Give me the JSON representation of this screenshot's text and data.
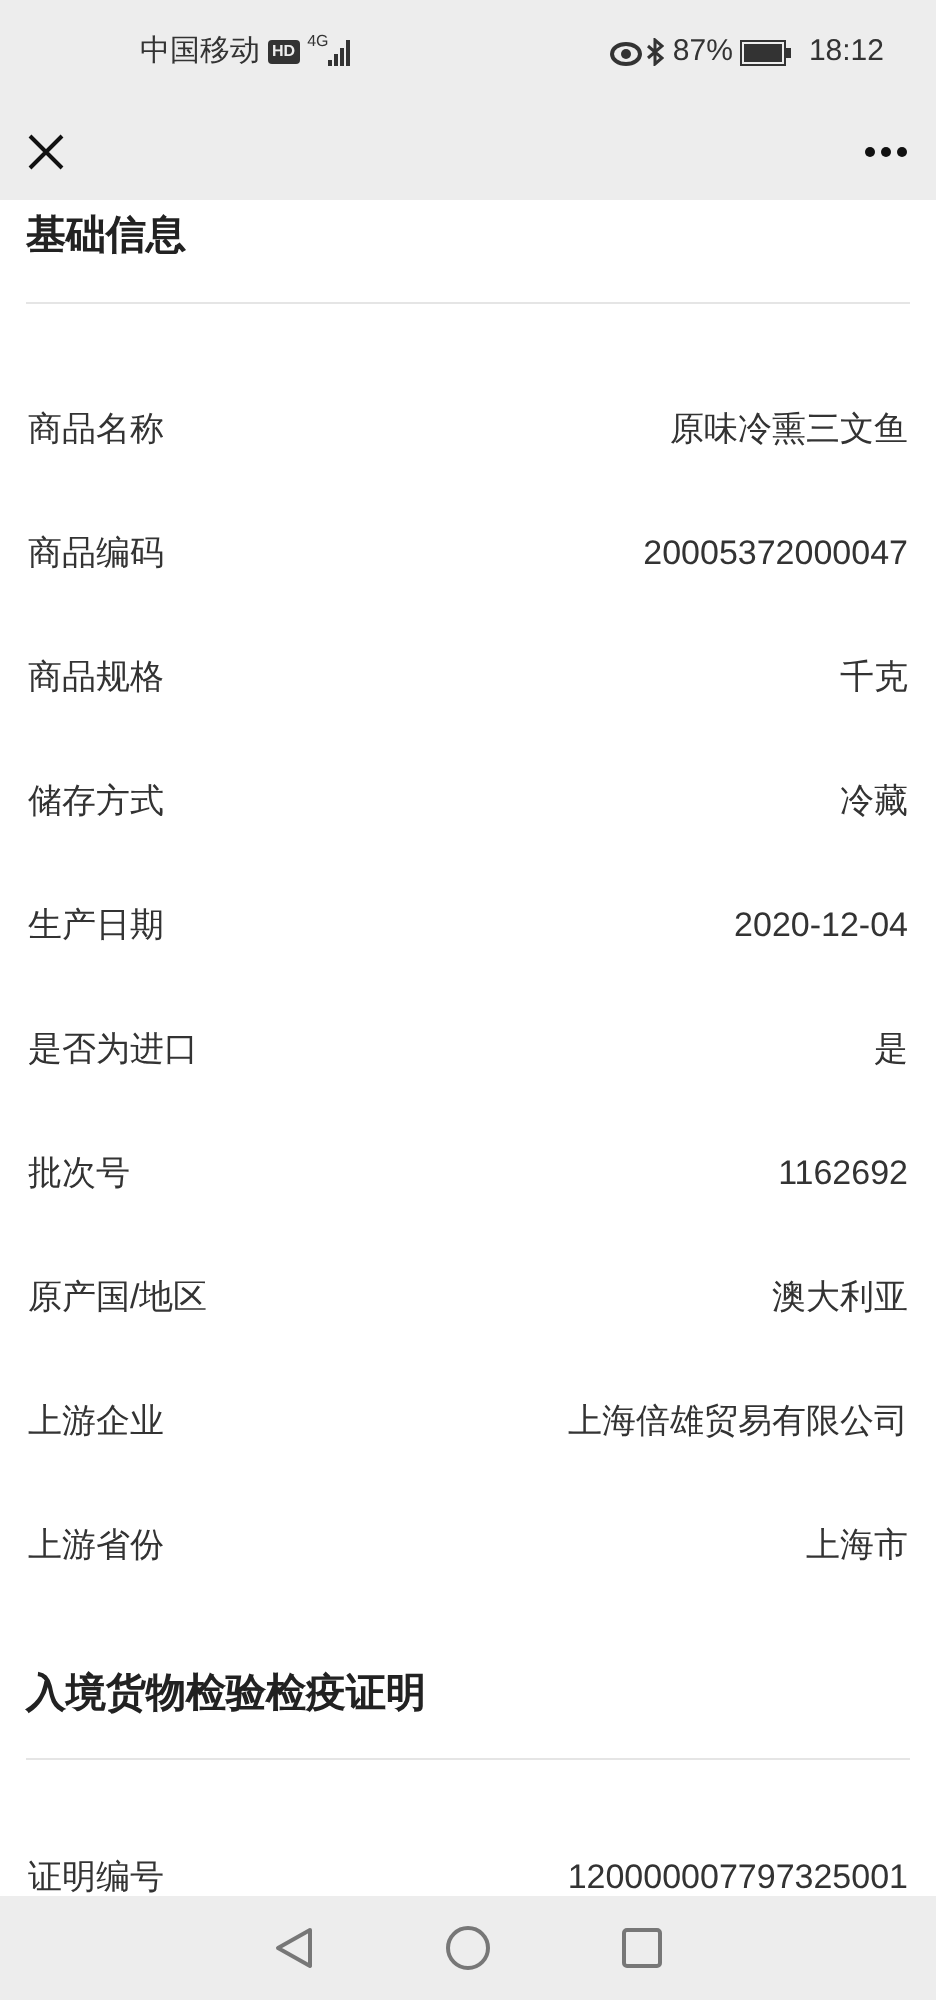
{
  "status_bar": {
    "carrier": "中国移动",
    "hd": "HD",
    "network": "4G",
    "battery": "87%",
    "time": "18:12"
  },
  "sections": [
    {
      "title": "基础信息",
      "rows": [
        {
          "label": "商品名称",
          "value": "原味冷熏三文鱼"
        },
        {
          "label": "商品编码",
          "value": "20005372000047"
        },
        {
          "label": "商品规格",
          "value": "千克"
        },
        {
          "label": "储存方式",
          "value": "冷藏"
        },
        {
          "label": "生产日期",
          "value": "2020-12-04"
        },
        {
          "label": "是否为进口",
          "value": "是"
        },
        {
          "label": "批次号",
          "value": "1162692"
        },
        {
          "label": "原产国/地区",
          "value": "澳大利亚"
        },
        {
          "label": "上游企业",
          "value": "上海倍雄贸易有限公司"
        },
        {
          "label": "上游省份",
          "value": "上海市"
        }
      ]
    },
    {
      "title": "入境货物检验检疫证明",
      "rows": [
        {
          "label": "证明编号",
          "value": "120000007797325001"
        }
      ]
    }
  ]
}
